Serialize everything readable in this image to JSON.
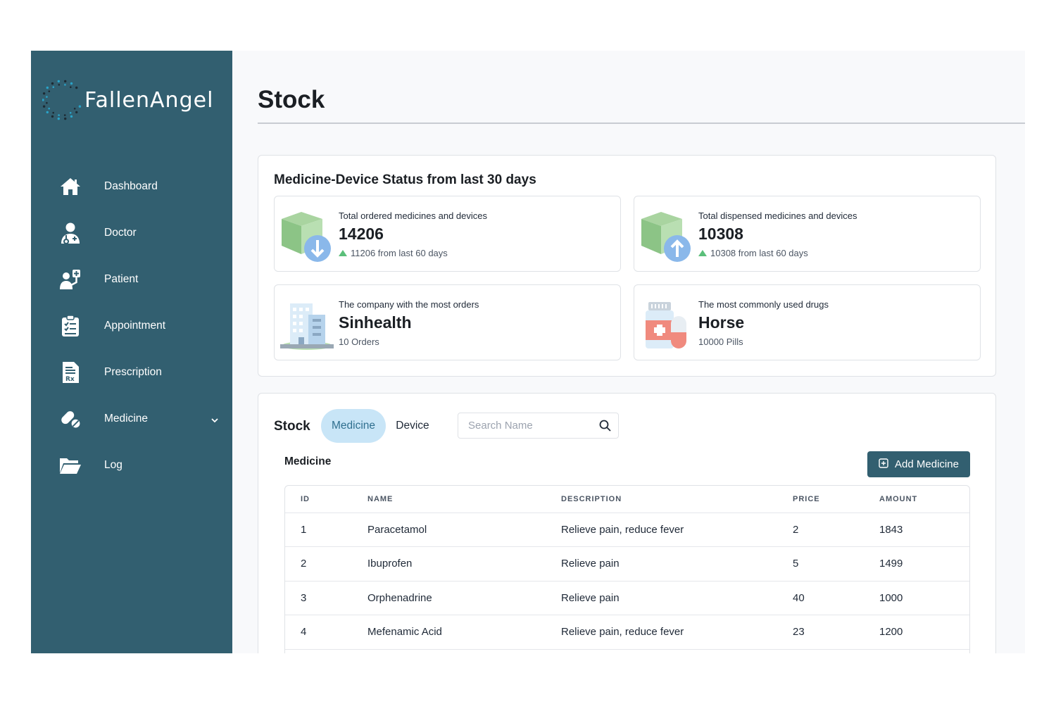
{
  "brand": {
    "name": "FallenAngel"
  },
  "sidebar": {
    "items": [
      {
        "label": "Dashboard",
        "icon": "home-icon"
      },
      {
        "label": "Doctor",
        "icon": "doctor-icon"
      },
      {
        "label": "Patient",
        "icon": "patient-icon"
      },
      {
        "label": "Appointment",
        "icon": "clipboard-icon"
      },
      {
        "label": "Prescription",
        "icon": "prescription-icon"
      },
      {
        "label": "Medicine",
        "icon": "pills-icon",
        "expandable": true
      },
      {
        "label": "Log",
        "icon": "folder-icon"
      }
    ]
  },
  "page": {
    "title": "Stock"
  },
  "status": {
    "heading": "Medicine-Device Status from last 30 days",
    "cards": [
      {
        "label": "Total ordered medicines and devices",
        "value": "14206",
        "sub": "11206 from last 60 days",
        "icon": "box-down-icon",
        "trend": "up"
      },
      {
        "label": "Total dispensed medicines and devices",
        "value": "10308",
        "sub": "10308 from last 60 days",
        "icon": "box-up-icon",
        "trend": "up"
      },
      {
        "label": "The company with the most orders",
        "value": "Sinhealth",
        "sub": "10 Orders",
        "icon": "building-icon"
      },
      {
        "label": "The most commonly used drugs",
        "value": "Horse",
        "sub": "10000 Pills",
        "icon": "pill-bottle-icon"
      }
    ]
  },
  "stock": {
    "title": "Stock",
    "tabs": [
      {
        "label": "Medicine",
        "active": true
      },
      {
        "label": "Device",
        "active": false
      }
    ],
    "search": {
      "placeholder": "Search Name",
      "value": ""
    },
    "section_label": "Medicine",
    "add_button": "Add Medicine",
    "table": {
      "columns": [
        "ID",
        "NAME",
        "DESCRIPTION",
        "PRICE",
        "AMOUNT"
      ],
      "rows": [
        [
          "1",
          "Paracetamol",
          "Relieve pain, reduce fever",
          "2",
          "1843"
        ],
        [
          "2",
          "Ibuprofen",
          "Relieve pain",
          "5",
          "1499"
        ],
        [
          "3",
          "Orphenadrine",
          "Relieve pain",
          "40",
          "1000"
        ],
        [
          "4",
          "Mefenamic Acid",
          "Relieve pain, reduce fever",
          "23",
          "1200"
        ]
      ]
    }
  },
  "colors": {
    "sidebar": "#325f70",
    "active_tab_bg": "#c8e5f7",
    "trend_up": "#5bbf7a",
    "primary_button": "#325f70"
  }
}
